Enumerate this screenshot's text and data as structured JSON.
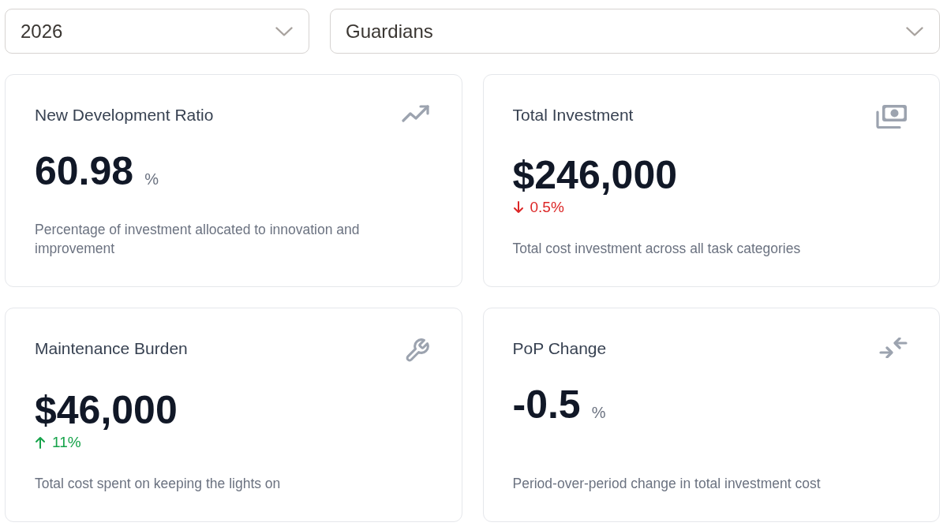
{
  "filters": [
    {
      "value": "2026"
    },
    {
      "value": "Guardians"
    }
  ],
  "cards": [
    {
      "title": "New Development Ratio",
      "value": "60.98",
      "unit": "%",
      "description": "Percentage of investment allocated to innovation and improvement"
    },
    {
      "title": "Total Investment",
      "value": "$246,000",
      "change": {
        "increase": false,
        "text": "0.5%"
      },
      "description": "Total cost investment across all task categories"
    },
    {
      "title": "Maintenance Burden",
      "value": "$46,000",
      "change": {
        "increase": true,
        "text": "11%"
      },
      "description": "Total cost spent on keeping the lights on"
    },
    {
      "title": "PoP Change",
      "value": "-0.5",
      "unit": "%",
      "description": "Period-over-period change in total investment cost"
    }
  ]
}
